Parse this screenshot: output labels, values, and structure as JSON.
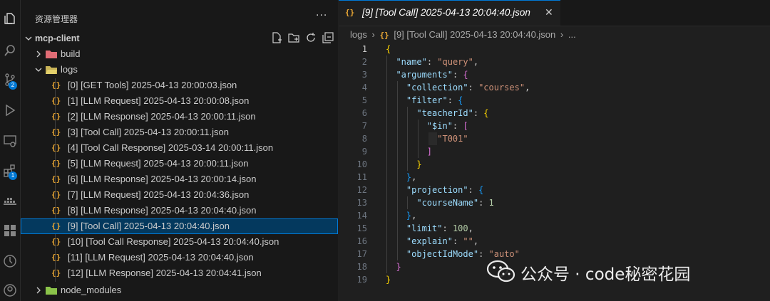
{
  "activity_bar": {
    "badges": {
      "source_control": "2",
      "extensions": "1"
    }
  },
  "sidebar": {
    "title": "资源管理器",
    "more": "···",
    "project": "mcp-client",
    "folders": {
      "build": "build",
      "logs": "logs",
      "node_modules": "node_modules"
    },
    "files": [
      "[0] [GET Tools] 2025-04-13 20:00:03.json",
      "[1] [LLM Request] 2025-04-13 20:00:08.json",
      "[2] [LLM Response] 2025-04-13 20:00:11.json",
      "[3] [Tool Call] 2025-04-13 20:00:11.json",
      "[4] [Tool Call Response] 2025-03-14 20:00:11.json",
      "[5] [LLM Request] 2025-04-13 20:00:11.json",
      "[6] [LLM Response] 2025-04-13 20:00:14.json",
      "[7] [LLM Request] 2025-04-13 20:04:36.json",
      "[8] [LLM Response] 2025-04-13 20:04:40.json",
      "[9] [Tool Call] 2025-04-13 20:04:40.json",
      "[10] [Tool Call Response] 2025-04-13 20:04:40.json",
      "[11] [LLM Request] 2025-04-13 20:04:40.json",
      "[12] [LLM Response] 2025-04-13 20:04:41.json"
    ],
    "json_glyph": "{}",
    "selected_file": "[9] [Tool Call] 2025-04-13 20:04:40.json"
  },
  "editor": {
    "tab_title": "[9] [Tool Call] 2025-04-13 20:04:40.json",
    "tab_close": "✕",
    "breadcrumb": {
      "folder": "logs",
      "file": "[9] [Tool Call] 2025-04-13 20:04:40.json",
      "tail": "...",
      "sep": "›"
    },
    "line_numbers": [
      "1",
      "2",
      "3",
      "4",
      "5",
      "6",
      "7",
      "8",
      "9",
      "10",
      "11",
      "12",
      "13",
      "14",
      "15",
      "16",
      "17",
      "18",
      "19"
    ],
    "code": {
      "name_key": "\"name\"",
      "name_val": "\"query\"",
      "arguments_key": "\"arguments\"",
      "collection_key": "\"collection\"",
      "collection_val": "\"courses\"",
      "filter_key": "\"filter\"",
      "teacherId_key": "\"teacherId\"",
      "in_key": "\"$in\"",
      "t001_val": "\"T001\"",
      "projection_key": "\"projection\"",
      "courseName_key": "\"courseName\"",
      "courseName_val": "1",
      "limit_key": "\"limit\"",
      "limit_val": "100",
      "explain_key": "\"explain\"",
      "explain_val": "\"\"",
      "objectIdMode_key": "\"objectIdMode\"",
      "objectIdMode_val": "\"auto\""
    }
  },
  "watermark": {
    "text": "公众号 · code秘密花园"
  }
}
